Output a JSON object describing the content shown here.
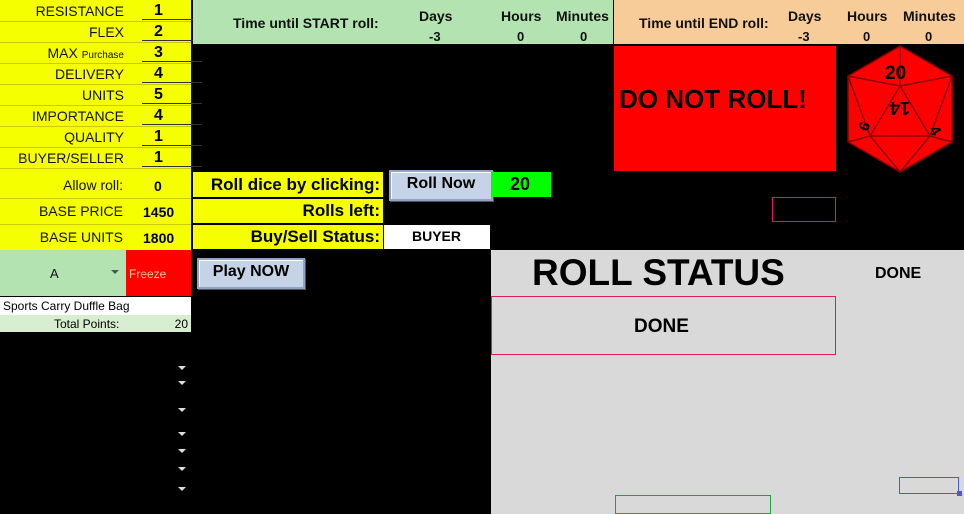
{
  "params": [
    {
      "label": "RESISTANCE",
      "value": "1"
    },
    {
      "label": "FLEX",
      "value": "2"
    },
    {
      "label": "MAX",
      "small": "Purchase",
      "value": "3"
    },
    {
      "label": "DELIVERY",
      "value": "4"
    },
    {
      "label": "UNITS",
      "value": "5"
    },
    {
      "label": "IMPORTANCE",
      "value": "4"
    },
    {
      "label": "QUALITY",
      "value": "1"
    },
    {
      "label": "BUYER/SELLER",
      "value": "1"
    }
  ],
  "allow_roll": {
    "label": "Allow roll:",
    "value": "0"
  },
  "base_price": {
    "label": "BASE PRICE",
    "value": "1450"
  },
  "base_units": {
    "label": "BASE UNITS",
    "value": "1800"
  },
  "start_timer": {
    "label": "Time until START roll:",
    "days_label": "Days",
    "hours_label": "Hours",
    "minutes_label": "Minutes",
    "days": "-3",
    "hours": "0",
    "minutes": "0"
  },
  "end_timer": {
    "label": "Time until END roll:",
    "days_label": "Days",
    "hours_label": "Hours",
    "minutes_label": "Minutes",
    "days": "-3",
    "hours": "0",
    "minutes": "0"
  },
  "warning": "DO NOT ROLL!",
  "dice": {
    "top_number": "20",
    "center_number": "14",
    "left_number": "6",
    "right_number": "4",
    "icon": "d20-dice-icon"
  },
  "roll": {
    "label": "Roll dice by clicking:",
    "button": "Roll Now",
    "result": "20"
  },
  "rolls_left": {
    "label": "Rolls left:",
    "value": ""
  },
  "buy_sell": {
    "label": "Buy/Sell Status:",
    "value": "BUYER"
  },
  "selector": {
    "value": "A",
    "freeze": "Freeze"
  },
  "play_button": "Play NOW",
  "product": "Sports Carry Duffle Bag",
  "total_points": {
    "label": "Total Points:",
    "value": "20"
  },
  "roll_status": {
    "title": "ROLL STATUS",
    "side": "DONE",
    "box": "DONE"
  },
  "colors": {
    "yellow": "#f5ff00",
    "green": "#b3e3b0",
    "peach": "#f8cc98",
    "red": "#ff0000",
    "lime": "#00ff00",
    "gray": "#d9d9d9",
    "pink": "#e0186a"
  }
}
